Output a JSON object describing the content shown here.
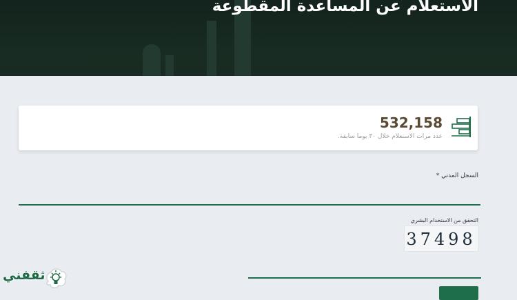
{
  "header": {
    "title": "الاستعلام عن المساعدة المقطوعة"
  },
  "stats": {
    "value": "532,158",
    "caption": "عدد مرات الاستعلام خلال ٣٠ يوما سابقة.",
    "icon": "bar-chart-icon"
  },
  "form": {
    "civil_registry_label": "السجل المدني *",
    "civil_registry_value": "",
    "captcha_label": "التحقق من الاستخدام البشري",
    "captcha_code": "37498",
    "captcha_value": "",
    "submit_label": ""
  },
  "watermark": {
    "text": "ثقفني",
    "icon": "lightbulb-icon"
  },
  "colors": {
    "accent": "#1f6e4a",
    "header_bg": "#172a21",
    "page_bg": "#e9edf1",
    "stat_value": "#5a4a32"
  }
}
